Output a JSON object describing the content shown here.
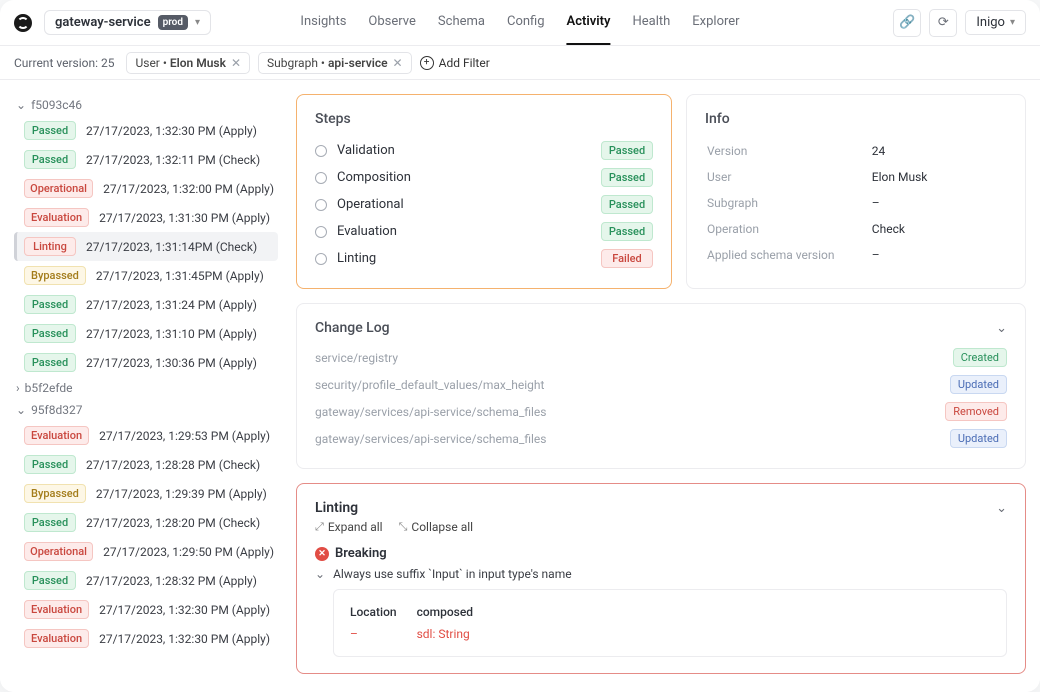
{
  "topbar": {
    "service_name": "gateway-service",
    "env": "prod",
    "nav": [
      "Insights",
      "Observe",
      "Schema",
      "Config",
      "Activity",
      "Health",
      "Explorer"
    ],
    "active_nav": "Activity",
    "account": "Inigo"
  },
  "filter": {
    "version_label": "Current version: 25",
    "chips": [
      {
        "key": "User",
        "value": "Elon Musk"
      },
      {
        "key": "Subgraph",
        "value": "api-service"
      }
    ],
    "add_filter": "Add Filter"
  },
  "commits": [
    {
      "hash": "f5093c46",
      "open": true,
      "rows": [
        {
          "badge": "Passed",
          "cls": "b-passed",
          "ts": "27/17/2023, 1:32:30 PM (Apply)"
        },
        {
          "badge": "Passed",
          "cls": "b-passed",
          "ts": "27/17/2023, 1:32:11 PM (Check)"
        },
        {
          "badge": "Operational",
          "cls": "b-oper",
          "ts": "27/17/2023, 1:32:00 PM (Apply)"
        },
        {
          "badge": "Evaluation",
          "cls": "b-eval",
          "ts": "27/17/2023, 1:31:30 PM (Apply)"
        },
        {
          "badge": "Linting",
          "cls": "b-lint",
          "ts": "27/17/2023, 1:31:14PM (Check)",
          "sel": true
        },
        {
          "badge": "Bypassed",
          "cls": "b-bypass",
          "ts": "27/17/2023, 1:31:45PM (Apply)"
        },
        {
          "badge": "Passed",
          "cls": "b-passed",
          "ts": "27/17/2023, 1:31:24 PM (Apply)"
        },
        {
          "badge": "Passed",
          "cls": "b-passed",
          "ts": "27/17/2023, 1:31:10 PM (Apply)"
        },
        {
          "badge": "Passed",
          "cls": "b-passed",
          "ts": "27/17/2023, 1:30:36 PM (Apply)"
        }
      ]
    },
    {
      "hash": "b5f2efde",
      "open": false,
      "rows": []
    },
    {
      "hash": "95f8d327",
      "open": true,
      "rows": [
        {
          "badge": "Evaluation",
          "cls": "b-eval",
          "ts": "27/17/2023, 1:29:53 PM (Apply)"
        },
        {
          "badge": "Passed",
          "cls": "b-passed",
          "ts": "27/17/2023, 1:28:28 PM (Check)"
        },
        {
          "badge": "Bypassed",
          "cls": "b-bypass",
          "ts": "27/17/2023, 1:29:39 PM (Apply)"
        },
        {
          "badge": "Passed",
          "cls": "b-passed",
          "ts": "27/17/2023, 1:28:20 PM (Check)"
        },
        {
          "badge": "Operational",
          "cls": "b-oper",
          "ts": "27/17/2023, 1:29:50 PM (Apply)"
        },
        {
          "badge": "Passed",
          "cls": "b-passed",
          "ts": "27/17/2023, 1:28:32 PM (Apply)"
        },
        {
          "badge": "Evaluation",
          "cls": "b-eval",
          "ts": "27/17/2023, 1:32:30 PM (Apply)"
        },
        {
          "badge": "Evaluation",
          "cls": "b-eval",
          "ts": "27/17/2023, 1:32:30 PM (Apply)"
        }
      ]
    }
  ],
  "steps": {
    "title": "Steps",
    "items": [
      {
        "name": "Validation",
        "status": "Passed",
        "cls": "b-passed"
      },
      {
        "name": "Composition",
        "status": "Passed",
        "cls": "b-passed"
      },
      {
        "name": "Operational",
        "status": "Passed",
        "cls": "b-passed"
      },
      {
        "name": "Evaluation",
        "status": "Passed",
        "cls": "b-passed"
      },
      {
        "name": "Linting",
        "status": "Failed",
        "cls": "b-failed"
      }
    ]
  },
  "info": {
    "title": "Info",
    "rows": [
      {
        "k": "Version",
        "v": "24",
        "link": true
      },
      {
        "k": "User",
        "v": "Elon Musk",
        "link": true
      },
      {
        "k": "Subgraph",
        "v": "–",
        "dash": true
      },
      {
        "k": "Operation",
        "v": "Check",
        "link": true
      },
      {
        "k": "Applied schema version",
        "v": "–",
        "dash": true
      }
    ]
  },
  "changelog": {
    "title": "Change Log",
    "rows": [
      {
        "path": "service/registry",
        "tag": "Created",
        "cls": "cb-created"
      },
      {
        "path": "security/profile_default_values/max_height",
        "tag": "Updated",
        "cls": "cb-updated"
      },
      {
        "path": "gateway/services/api-service/schema_files",
        "tag": "Removed",
        "cls": "cb-removed"
      },
      {
        "path": "gateway/services/api-service/schema_files",
        "tag": "Updated",
        "cls": "cb-updated"
      }
    ]
  },
  "linting": {
    "title": "Linting",
    "expand": "Expand all",
    "collapse": "Collapse all",
    "section": "Breaking",
    "rule": "Always use suffix `Input` in input type's name",
    "detail_headers": [
      "Location",
      "composed"
    ],
    "detail_row": [
      "–",
      "sdl: String"
    ]
  }
}
